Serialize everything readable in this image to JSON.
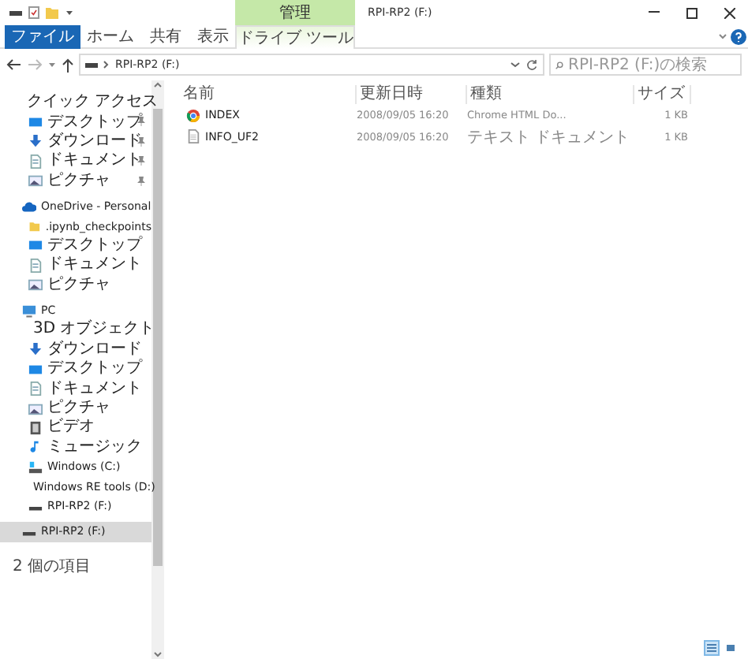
{
  "window": {
    "title": "RPI-RP2 (F:)",
    "context_tab": "管理"
  },
  "ribbon": {
    "tabs": [
      {
        "label": "ファイル",
        "kind": "file"
      },
      {
        "label": "ホーム",
        "kind": "plain"
      },
      {
        "label": "共有",
        "kind": "plain"
      },
      {
        "label": "表示",
        "kind": "plain"
      },
      {
        "label": "ドライブ ツール",
        "kind": "context"
      }
    ]
  },
  "address": {
    "path": "RPI-RP2 (F:)"
  },
  "search": {
    "placeholder": "RPI-RP2 (F:)の検索"
  },
  "sidebar": {
    "items": [
      {
        "label": "クイック アクセス",
        "kind": "star",
        "selected": false,
        "children": [
          {
            "label": "デスクトップ",
            "kind": "desktop",
            "pinned": true,
            "selected": false
          },
          {
            "label": "ダウンロード",
            "kind": "download",
            "pinned": true,
            "selected": false
          },
          {
            "label": "ドキュメント",
            "kind": "document",
            "pinned": true,
            "selected": false
          },
          {
            "label": "ピクチャ",
            "kind": "picture",
            "pinned": true,
            "selected": false
          }
        ]
      },
      {
        "label": "OneDrive - Personal",
        "kind": "cloud",
        "selected": false,
        "children": [
          {
            "label": ".ipynb_checkpoints",
            "kind": "folder",
            "selected": false
          },
          {
            "label": "デスクトップ",
            "kind": "desktop",
            "selected": false
          },
          {
            "label": "ドキュメント",
            "kind": "document",
            "selected": false
          },
          {
            "label": "ピクチャ",
            "kind": "picture",
            "selected": false
          }
        ]
      },
      {
        "label": "PC",
        "kind": "pc",
        "selected": false,
        "children": [
          {
            "label": "3D オブジェクト",
            "kind": "cube",
            "selected": false
          },
          {
            "label": "ダウンロード",
            "kind": "download",
            "selected": false
          },
          {
            "label": "デスクトップ",
            "kind": "desktop",
            "selected": false
          },
          {
            "label": "ドキュメント",
            "kind": "document",
            "selected": false
          },
          {
            "label": "ピクチャ",
            "kind": "picture",
            "selected": false
          },
          {
            "label": "ビデオ",
            "kind": "video",
            "selected": false
          },
          {
            "label": "ミュージック",
            "kind": "music",
            "selected": false
          },
          {
            "label": "Windows (C:)",
            "kind": "osdrive",
            "selected": false
          },
          {
            "label": "Windows RE tools (D:)",
            "kind": "drive",
            "selected": false
          },
          {
            "label": "RPI-RP2 (F:)",
            "kind": "drive",
            "selected": false
          }
        ]
      },
      {
        "label": "RPI-RP2 (F:)",
        "kind": "drive",
        "selected": true
      }
    ]
  },
  "table": {
    "columns": [
      "名前",
      "更新日時",
      "種類",
      "サイズ"
    ],
    "rows": [
      {
        "kind": "chrome",
        "name": "INDEX",
        "modified": "2008/09/05 16:20",
        "type": "Chrome HTML Do...",
        "size": "1 KB"
      },
      {
        "kind": "text",
        "name": "INFO_UF2",
        "modified": "2008/09/05 16:20",
        "type": "テキスト ドキュメント",
        "size": "1 KB"
      }
    ]
  },
  "status_bar": {
    "count": "2 個の項目"
  },
  "view_buttons": [
    {
      "kind": "details",
      "selected": true
    },
    {
      "kind": "tiles",
      "selected": false
    }
  ]
}
